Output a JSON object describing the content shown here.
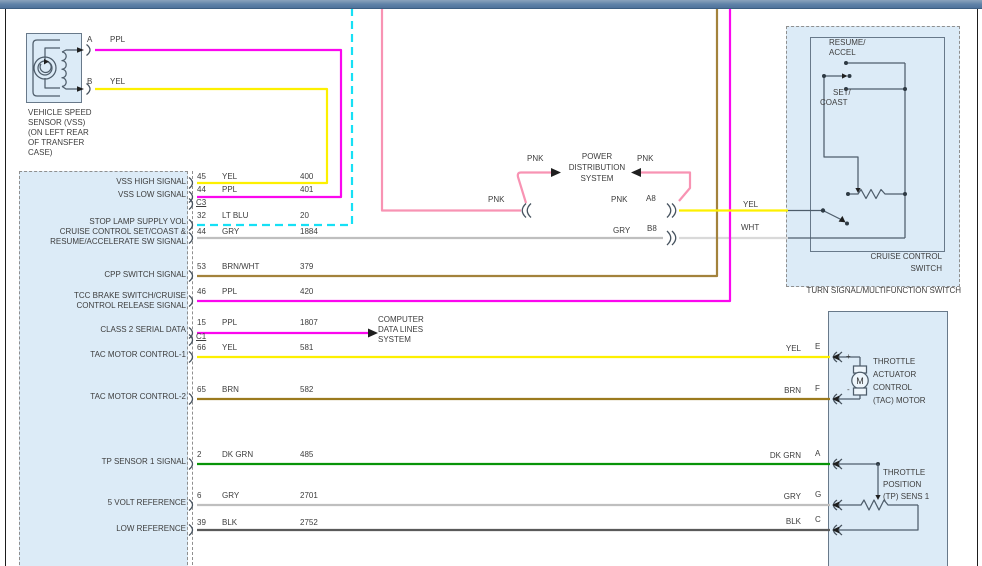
{
  "colors": {
    "pnk": "#f893b3",
    "ppl": "#fb07ef",
    "yel": "#fdf000",
    "lt_blu": "#16e0f5",
    "gry": "#bfbfbf",
    "wht": "#d9d9d9",
    "brn_wht": "#a3823c",
    "brn": "#9b7a1e",
    "dk_grn": "#089408",
    "blk": "#5a5a5a",
    "box_fill": "#dcebf7"
  },
  "vss_sensor": {
    "terminal_a": "A",
    "terminal_b": "B",
    "wire_a_color": "PPL",
    "wire_b_color": "YEL",
    "label_lines": [
      "VEHICLE SPEED",
      "SENSOR (VSS)",
      "(ON LEFT REAR",
      "OF TRANSFER",
      "CASE)"
    ]
  },
  "pcm": {
    "connector_c3": "C3",
    "connector_c1": "C1",
    "signals": [
      "VSS HIGH SIGNAL",
      "VSS LOW SIGNAL",
      "STOP LAMP SUPPLY VOL",
      "CRUISE CONTROL SET/COAST &",
      "RESUME/ACCELERATE SW SIGNAL",
      "CPP SWITCH SIGNAL",
      "TCC BRAKE SWITCH/CRUISE",
      "CONTROL RELEASE SIGNAL",
      "CLASS 2 SERIAL DATA",
      "TAC MOTOR CONTROL-1",
      "TAC MOTOR CONTROL-2",
      "TP SENSOR 1 SIGNAL",
      "5 VOLT REFERENCE",
      "LOW REFERENCE"
    ],
    "wires": [
      {
        "pin": "45",
        "color": "YEL",
        "circuit": "400"
      },
      {
        "pin": "44",
        "color": "PPL",
        "circuit": "401"
      },
      {
        "pin": "32",
        "color": "LT BLU",
        "circuit": "20"
      },
      {
        "pin": "44",
        "color": "GRY",
        "circuit": "1884"
      },
      {
        "pin": "53",
        "color": "BRN/WHT",
        "circuit": "379"
      },
      {
        "pin": "46",
        "color": "PPL",
        "circuit": "420"
      },
      {
        "pin": "15",
        "color": "PPL",
        "circuit": "1807"
      },
      {
        "pin": "66",
        "color": "YEL",
        "circuit": "581"
      },
      {
        "pin": "65",
        "color": "BRN",
        "circuit": "582"
      },
      {
        "pin": "2",
        "color": "DK GRN",
        "circuit": "485"
      },
      {
        "pin": "6",
        "color": "GRY",
        "circuit": "2701"
      },
      {
        "pin": "39",
        "color": "BLK",
        "circuit": "2752"
      }
    ]
  },
  "power_distribution": {
    "title_lines": [
      "POWER",
      "DISTRIBUTION",
      "SYSTEM"
    ],
    "pnk": "PNK",
    "connector_a8": "A8",
    "connector_b8": "B8",
    "gry": "GRY",
    "yel": "YEL",
    "wht": "WHT"
  },
  "computer_data_lines": {
    "title_lines": [
      "COMPUTER",
      "DATA LINES",
      "SYSTEM"
    ]
  },
  "cruise_switch": {
    "resume_lines": [
      "RESUME/",
      "ACCEL"
    ],
    "set_lines": [
      "SET/",
      "COAST"
    ],
    "name_lines": [
      "CRUISE CONTROL",
      "SWITCH"
    ],
    "outer_name": "TURN SIGNAL/MULTIFUNCTION SWITCH"
  },
  "tac_motor": {
    "name_lines": [
      "THROTTLE",
      "ACTUATOR",
      "CONTROL",
      "(TAC) MOTOR"
    ],
    "motor_letter": "M",
    "plus": "+",
    "minus": "-"
  },
  "tp_sensor": {
    "name_lines": [
      "THROTTLE",
      "POSITION",
      "(TP) SENS 1"
    ]
  },
  "right_connector": {
    "terminals": [
      {
        "letter": "E",
        "color": "YEL"
      },
      {
        "letter": "F",
        "color": "BRN"
      },
      {
        "letter": "A",
        "color": "DK GRN"
      },
      {
        "letter": "G",
        "color": "GRY"
      },
      {
        "letter": "C",
        "color": "BLK"
      }
    ]
  }
}
